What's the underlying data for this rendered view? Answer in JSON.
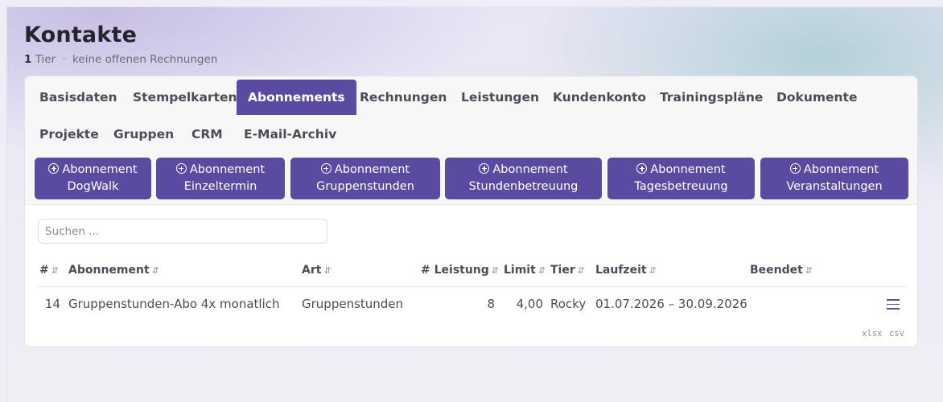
{
  "header": {
    "title": "Kontakte",
    "tier_count": "1",
    "tier_label": "Tier",
    "separator": "·",
    "invoice_status": "keine offenen Rechnungen"
  },
  "tabs": [
    {
      "label": "Basisdaten",
      "active": false
    },
    {
      "label": "Stempelkarten",
      "active": false
    },
    {
      "label": "Abonnements",
      "active": true
    },
    {
      "label": "Rechnungen",
      "active": false
    },
    {
      "label": "Leistungen",
      "active": false
    },
    {
      "label": "Kundenkonto",
      "active": false
    },
    {
      "label": "Trainingspläne",
      "active": false
    },
    {
      "label": "Dokumente",
      "active": false
    },
    {
      "label": "Projekte",
      "active": false
    },
    {
      "label": "Gruppen",
      "active": false
    },
    {
      "label": "CRM",
      "active": false
    },
    {
      "label": "E-Mail-Archiv",
      "active": false
    }
  ],
  "add_buttons": [
    {
      "line1": "Abonnement",
      "line2": "DogWalk"
    },
    {
      "line1": "Abonnement",
      "line2": "Einzeltermin"
    },
    {
      "line1": "Abonnement",
      "line2": "Gruppenstunden"
    },
    {
      "line1": "Abonnement",
      "line2": "Stundenbetreuung"
    },
    {
      "line1": "Abonnement",
      "line2": "Tagesbetreuung"
    },
    {
      "line1": "Abonnement",
      "line2": "Veranstaltungen"
    }
  ],
  "search": {
    "placeholder": "Suchen ...",
    "value": ""
  },
  "table": {
    "sort_icon": "⇵",
    "columns": [
      "#",
      "Abonnement",
      "Art",
      "# Leistung",
      "Limit",
      "Tier",
      "Laufzeit",
      "Beendet"
    ],
    "rows": [
      {
        "id": "14",
        "abonnement": "Gruppenstunden-Abo 4x monatlich",
        "art": "Gruppenstunden",
        "leistung": "8",
        "limit": "4,00",
        "tier": "Rocky",
        "laufzeit": "01.07.2026 – 30.09.2026",
        "beendet": ""
      }
    ],
    "row_action_icon": "menu-icon"
  },
  "export": {
    "xlsx": "xlsx",
    "csv": "csv"
  },
  "colors": {
    "accent": "#5b4ba0",
    "card_bg": "#ffffff",
    "tab_area_bg": "#f7f7f8"
  }
}
